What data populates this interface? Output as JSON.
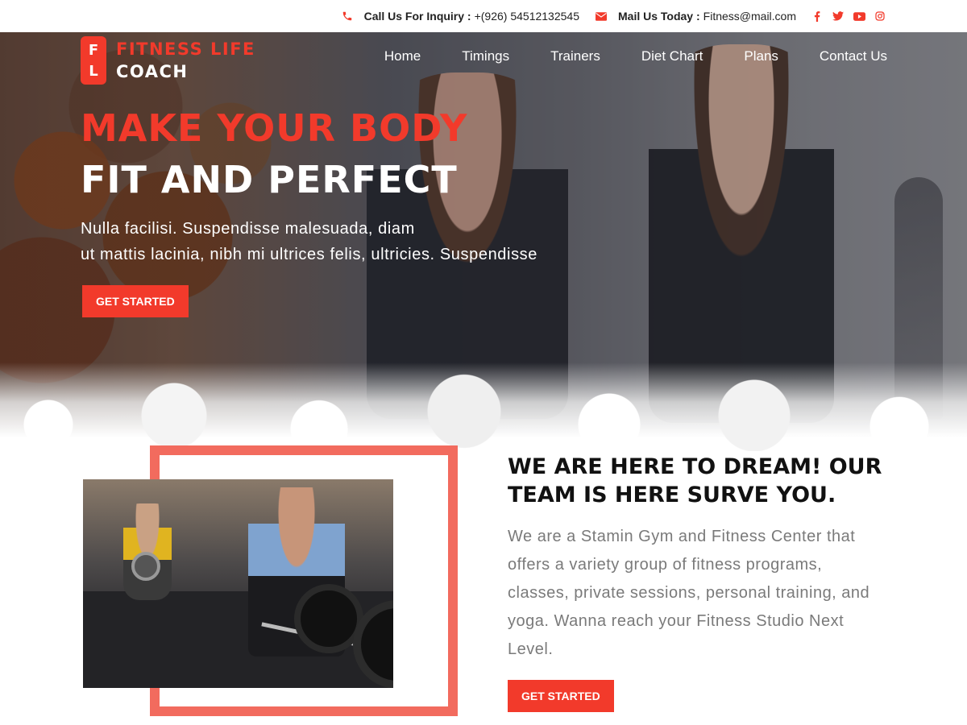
{
  "topbar": {
    "phone_label": "Call Us For Inquiry :",
    "phone": "+(926) 54512132545",
    "mail_label": "Mail Us Today :",
    "email": "Fitness@mail.com",
    "socials": [
      "facebook-icon",
      "twitter-icon",
      "youtube-icon",
      "instagram-icon"
    ]
  },
  "logo": {
    "badge_top": "F",
    "badge_bottom": "L",
    "line1": "FITNESS LIFE",
    "line2": "COACH"
  },
  "nav": {
    "items": [
      "Home",
      "Timings",
      "Trainers",
      "Diet Chart",
      "Plans",
      "Contact Us"
    ]
  },
  "hero": {
    "title_line1": "MAKE YOUR BODY",
    "title_line2": "FIT AND PERFECT",
    "desc_line1": "Nulla facilisi. Suspendisse malesuada, diam",
    "desc_line2": "ut mattis lacinia, nibh mi ultrices felis, ultricies. Suspendisse",
    "cta": "GET STARTED"
  },
  "about": {
    "title_line1": "WE ARE HERE TO DREAM! OUR",
    "title_line2": "TEAM IS HERE SURVE YOU.",
    "text": "We are a Stamin Gym and Fitness Center that offers a variety group of fitness programs, classes, private sessions, personal training, and yoga. Wanna reach your Fitness Studio Next Level.",
    "cta": "GET STARTED"
  },
  "colors": {
    "accent": "#f23a2b",
    "frame": "#f26b5e",
    "body_text": "#7a7a7a"
  }
}
